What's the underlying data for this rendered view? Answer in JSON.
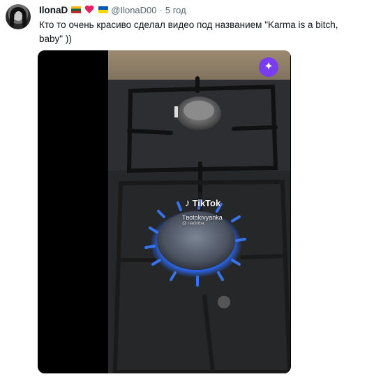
{
  "tweet": {
    "author_name": "IlonaD",
    "handle": "@IlonaD00",
    "separator": "·",
    "time": "5 год",
    "text_line1": "Кто то очень красиво сделал видео под названием \"Karma is a bitch,",
    "text_line2": "baby\" ))",
    "name_emojis": [
      "lithuania-flag",
      "red-heart",
      "ukraine-flag"
    ]
  },
  "media": {
    "sparkle_icon": "✦",
    "watermark_brand": "TikTok",
    "watermark_user": "Tвоtokivyanka",
    "watermark_subuser": "@ nadiriba"
  },
  "colors": {
    "text": "#0f1419",
    "secondary": "#536471",
    "badge": "#7a3cf0",
    "flame": "#2b6bff"
  }
}
